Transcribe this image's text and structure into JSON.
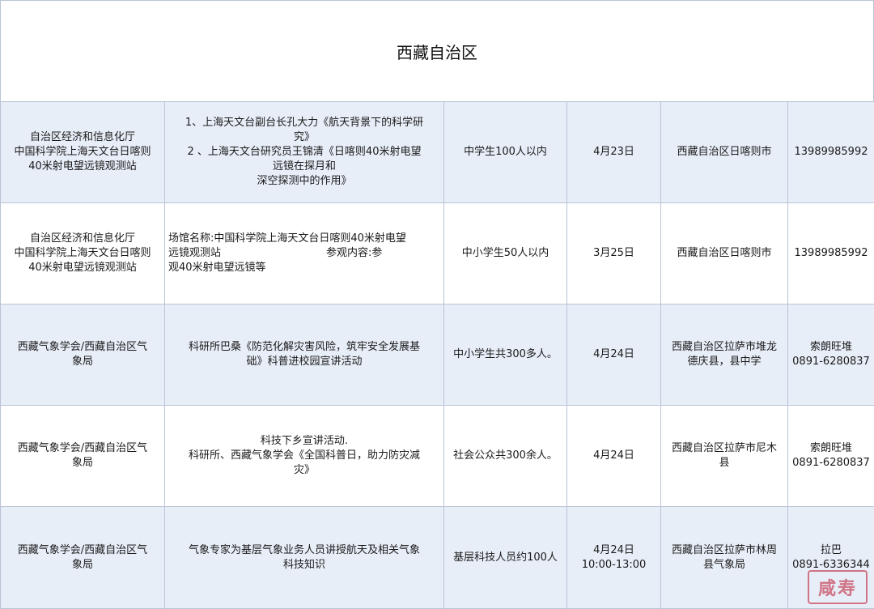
{
  "header": {
    "title": "西藏自治区"
  },
  "rows": [
    {
      "org": [
        "自治区经济和信息化厅",
        "中国科学院上海天文台日喀则",
        "40米射电望远镜观测站"
      ],
      "content": [
        "1、上海天文台副台长孔大力《航天背景下的科学研",
        "究》",
        "2 、上海天文台研究员王锦清《日喀则40米射电望",
        "远镜在探月和",
        "深空探测中的作用》"
      ],
      "audience": "中学生100人以内",
      "date": [
        "4月23日"
      ],
      "location": [
        "西藏自治区日喀则市"
      ],
      "contact": [
        "13989985992"
      ]
    },
    {
      "org": [
        "自治区经济和信息化厅",
        "中国科学院上海天文台日喀则",
        "40米射电望远镜观测站"
      ],
      "content": [
        "场馆名称:中国科学院上海天文台日喀则40米射电望",
        "远镜观测站　　　　　　　　　　参观内容:参",
        "观40米射电望远镜等"
      ],
      "audience": "中小学生50人以内",
      "date": [
        "3月25日"
      ],
      "location": [
        "西藏自治区日喀则市"
      ],
      "contact": [
        "13989985992"
      ]
    },
    {
      "org": [
        "西藏气象学会/西藏自治区气",
        "象局"
      ],
      "content": [
        "科研所巴桑《防范化解灾害风险，筑牢安全发展基",
        "础》科普进校园宣讲活动"
      ],
      "audience": "中小学生共300多人。",
      "date": [
        "4月24日"
      ],
      "location": [
        "西藏自治区拉萨市堆龙",
        "德庆县，县中学"
      ],
      "contact": [
        "索朗旺堆",
        "0891-6280837"
      ]
    },
    {
      "org": [
        "西藏气象学会/西藏自治区气",
        "象局"
      ],
      "content": [
        "科技下乡宣讲活动.",
        "科研所、西藏气象学会《全国科普日，助力防灾减",
        "灾》"
      ],
      "audience": "社会公众共300余人。",
      "date": [
        "4月24日"
      ],
      "location": [
        "西藏自治区拉萨市尼木",
        "县"
      ],
      "contact": [
        "索朗旺堆",
        "0891-6280837"
      ]
    },
    {
      "org": [
        "西藏气象学会/西藏自治区气",
        "象局"
      ],
      "content": [
        "气象专家为基层气象业务人员讲授航天及相关气象",
        "科技知识"
      ],
      "audience": "基层科技人员约100人",
      "date": [
        "4月24日",
        "10:00-13:00"
      ],
      "location": [
        "西藏自治区拉萨市林周",
        "县气象局"
      ],
      "contact": [
        "拉巴",
        "0891-6336344"
      ]
    }
  ],
  "watermark": {
    "text": "咸寿"
  }
}
